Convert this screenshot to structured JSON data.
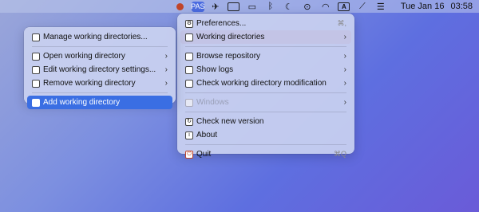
{
  "menubar": {
    "app_icon_label": "PAS",
    "input_label": "A",
    "date": "Tue Jan 16",
    "time": "03:58",
    "icons": [
      "record-dot-icon",
      "app-icon",
      "airplane-icon",
      "window-icon",
      "display-icon",
      "bluetooth-icon",
      "moon-icon",
      "play-icon",
      "headphones-icon",
      "input-source-icon",
      "pen-icon",
      "control-center-icon"
    ]
  },
  "main_menu": {
    "items": [
      {
        "label": "Preferences...",
        "shortcut": "⌘,",
        "icon": "gear-icon"
      },
      {
        "label": "Working directories",
        "icon": "folder-icon"
      },
      {
        "label": "Browse repository",
        "icon": "repository-icon"
      },
      {
        "label": "Show logs",
        "icon": "logs-icon"
      },
      {
        "label": "Check working directory modification",
        "icon": "check-icon"
      },
      {
        "label": "Windows",
        "icon": "windows-icon"
      },
      {
        "label": "Check new version",
        "icon": "update-icon"
      },
      {
        "label": "About",
        "icon": "info-icon"
      },
      {
        "label": "Quit",
        "shortcut": "⌘Q",
        "icon": "power-icon"
      }
    ]
  },
  "sub_menu": {
    "items": [
      {
        "label": "Manage working directories...",
        "icon": "manage-icon"
      },
      {
        "label": "Open working directory",
        "icon": "open-folder-icon"
      },
      {
        "label": "Edit working directory settings...",
        "icon": "edit-icon"
      },
      {
        "label": "Remove working directory",
        "icon": "remove-icon"
      },
      {
        "label": "Add working directory",
        "icon": "add-icon"
      }
    ]
  },
  "colors": {
    "accent": "#3a6ee3",
    "highlight": "#c3c4e6"
  }
}
